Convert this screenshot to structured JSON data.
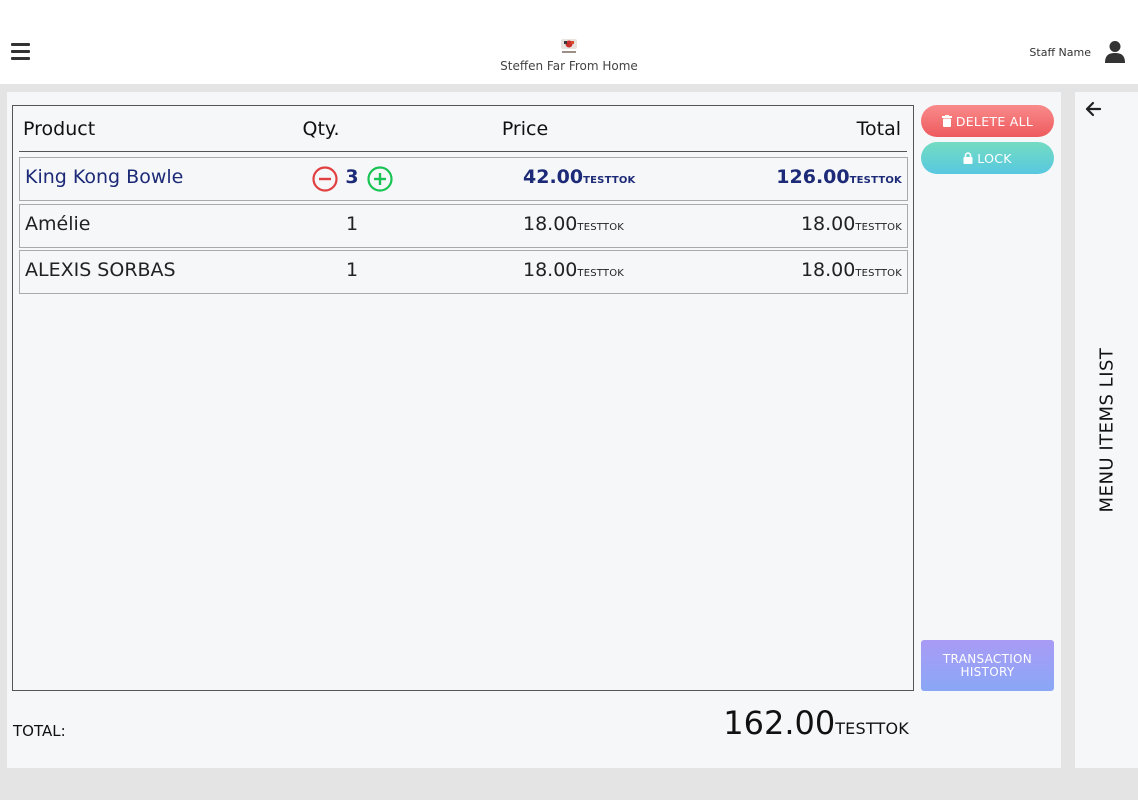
{
  "header": {
    "store_name": "Steffen Far From Home",
    "staff_name": "Staff Name"
  },
  "table": {
    "headers": {
      "product": "Product",
      "qty": "Qty.",
      "price": "Price",
      "total": "Total"
    },
    "currency": "TESTTOK",
    "rows": [
      {
        "name": "King Kong Bowle",
        "qty": "3",
        "price": "42.00",
        "total": "126.00",
        "selected": true
      },
      {
        "name": "Amélie",
        "qty": "1",
        "price": "18.00",
        "total": "18.00",
        "selected": false
      },
      {
        "name": "ALEXIS SORBAS",
        "qty": "1",
        "price": "18.00",
        "total": "18.00",
        "selected": false
      }
    ]
  },
  "actions": {
    "delete_all": "DELETE ALL",
    "lock": "LOCK",
    "history_line1": "TRANSACTION",
    "history_line2": "HISTORY"
  },
  "summary": {
    "label": "TOTAL:",
    "value": "162.00",
    "currency": "TESTTOK"
  },
  "side_panel": {
    "title": "MENU ITEMS LIST"
  },
  "colors": {
    "selected_text": "#1c2a77",
    "minus": "#e0403f",
    "plus": "#19c354",
    "delete": "#f06a6d",
    "lock": "#62d2d0",
    "history": "#9aa1f5"
  }
}
